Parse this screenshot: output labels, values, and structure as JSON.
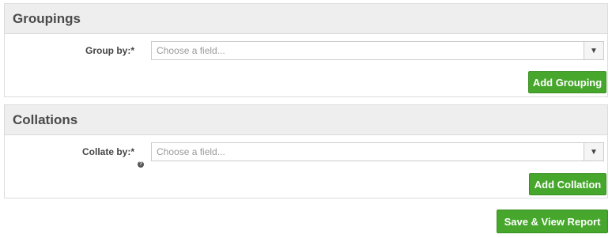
{
  "groupings": {
    "title": "Groupings",
    "label": "Group by:*",
    "placeholder": "Choose a field...",
    "button": "Add Grouping"
  },
  "collations": {
    "title": "Collations",
    "label": "Collate by:*",
    "help_icon": "?",
    "placeholder": "Choose a field...",
    "button": "Add Collation"
  },
  "save_button": "Save & View Report",
  "icons": {
    "dropdown": "chevron-down-icon",
    "help": "question-circle-icon"
  },
  "colors": {
    "button_green": "#46a72c",
    "header_bg": "#eeeeee"
  }
}
